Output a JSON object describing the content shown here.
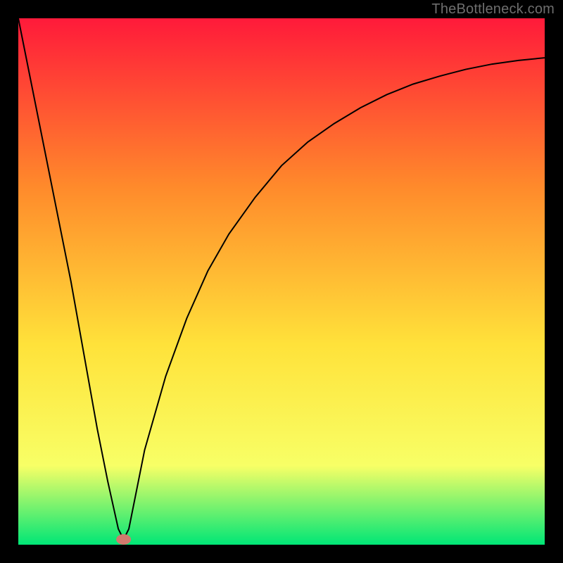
{
  "watermark": "TheBottleneck.com",
  "chart_data": {
    "type": "line",
    "title": "",
    "xlabel": "",
    "ylabel": "",
    "xlim": [
      0,
      100
    ],
    "ylim": [
      0,
      100
    ],
    "grid": false,
    "legend": false,
    "background_gradient": {
      "top": "#ff1a3a",
      "mid1": "#ff8a2b",
      "mid2": "#ffe23a",
      "mid3": "#f8ff66",
      "bottom": "#00e676"
    },
    "x": [
      0,
      5,
      10,
      15,
      17,
      19,
      20,
      21,
      22,
      24,
      28,
      32,
      36,
      40,
      45,
      50,
      55,
      60,
      65,
      70,
      75,
      80,
      85,
      90,
      95,
      100
    ],
    "values": [
      100,
      75,
      50,
      22,
      12,
      3,
      1,
      3,
      8,
      18,
      32,
      43,
      52,
      59,
      66,
      72,
      76.5,
      80,
      83,
      85.5,
      87.5,
      89,
      90.3,
      91.3,
      92,
      92.5
    ],
    "marker": {
      "x": 20,
      "y": 1,
      "color": "#d27a6e",
      "rx": 1.4,
      "ry": 1.0
    },
    "curve_color": "#000000",
    "curve_width": 2.0
  }
}
